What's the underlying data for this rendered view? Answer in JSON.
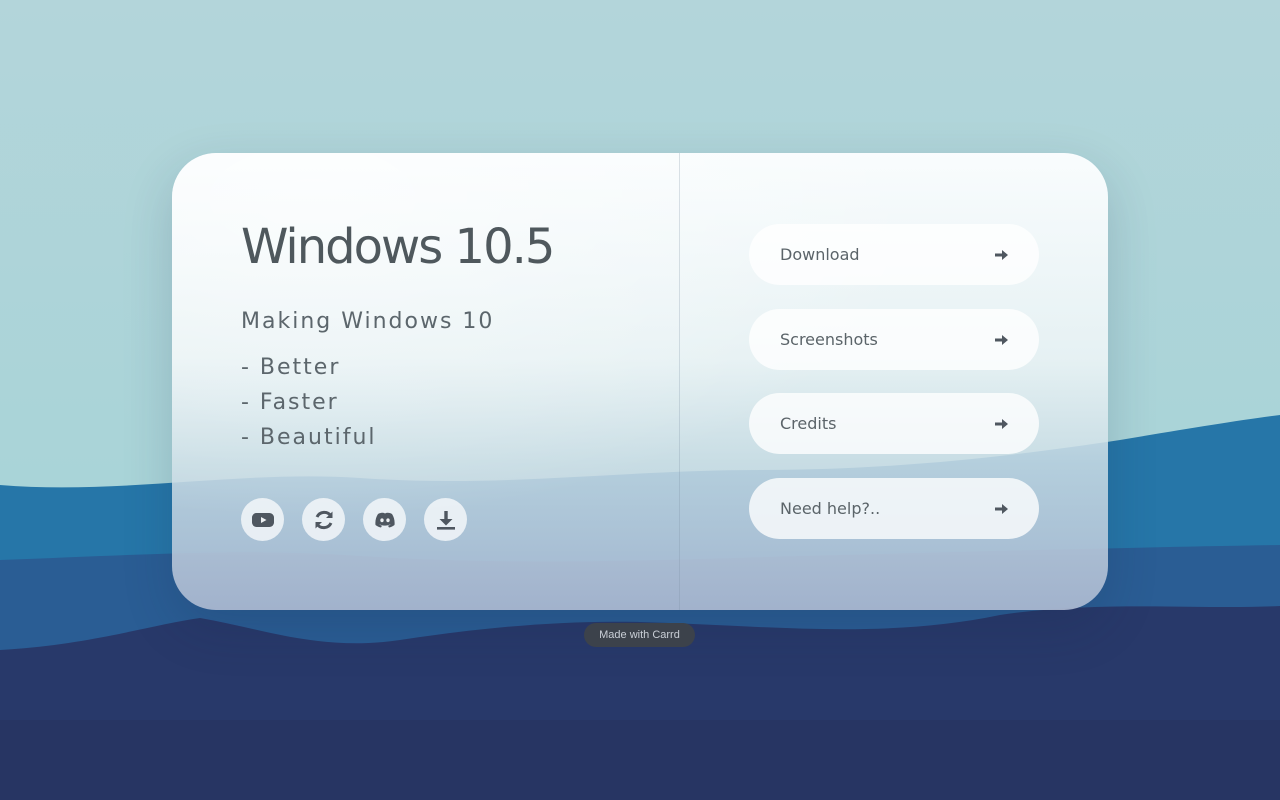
{
  "colors": {
    "sky": "#aed6d9",
    "hill_light": "#2474a6",
    "hill_dark": "#27365f",
    "text": "#4f585d",
    "badge": "#3c424b"
  },
  "card": {
    "title": "Windows 10.5",
    "subtitle": "Making Windows 10",
    "features": [
      "- Better",
      "- Faster",
      "- Beautiful"
    ],
    "social": [
      {
        "icon": "youtube-icon"
      },
      {
        "icon": "refresh-icon"
      },
      {
        "icon": "discord-icon"
      },
      {
        "icon": "download-icon"
      }
    ],
    "buttons": [
      {
        "label": "Download",
        "icon": "arrow-right-icon"
      },
      {
        "label": "Screenshots",
        "icon": "arrow-right-icon"
      },
      {
        "label": "Credits",
        "icon": "arrow-right-icon"
      },
      {
        "label": "Need help?..",
        "icon": "arrow-right-icon"
      }
    ]
  },
  "footer": {
    "badge": "Made with Carrd"
  }
}
